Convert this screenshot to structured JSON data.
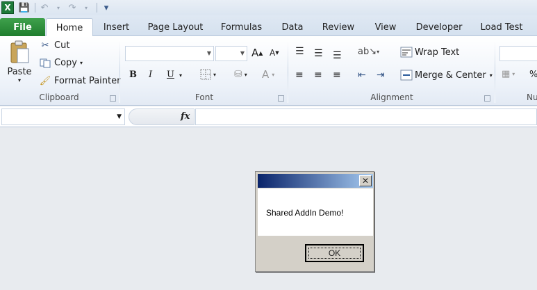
{
  "app": {
    "icon_letter": "X"
  },
  "qat": {
    "save": "💾",
    "undo": "↶",
    "redo": "↷",
    "customize": "▾"
  },
  "tabs": [
    "File",
    "Home",
    "Insert",
    "Page Layout",
    "Formulas",
    "Data",
    "Review",
    "View",
    "Developer",
    "Load Test"
  ],
  "clipboard": {
    "paste": "Paste",
    "cut": "Cut",
    "copy": "Copy",
    "format_painter": "Format Painter",
    "label": "Clipboard"
  },
  "font": {
    "label": "Font",
    "bold": "B",
    "italic": "I",
    "underline": "U",
    "grow": "A",
    "shrink": "A"
  },
  "alignment": {
    "label": "Alignment",
    "wrap": "Wrap Text",
    "merge": "Merge & Center"
  },
  "number": {
    "label": "Nu",
    "percent": "%"
  },
  "formula_bar": {
    "fx": "fx",
    "namebox_value": "",
    "formula_value": ""
  },
  "dialog": {
    "message": "Shared AddIn Demo!",
    "ok": "OK",
    "close": "✕"
  }
}
